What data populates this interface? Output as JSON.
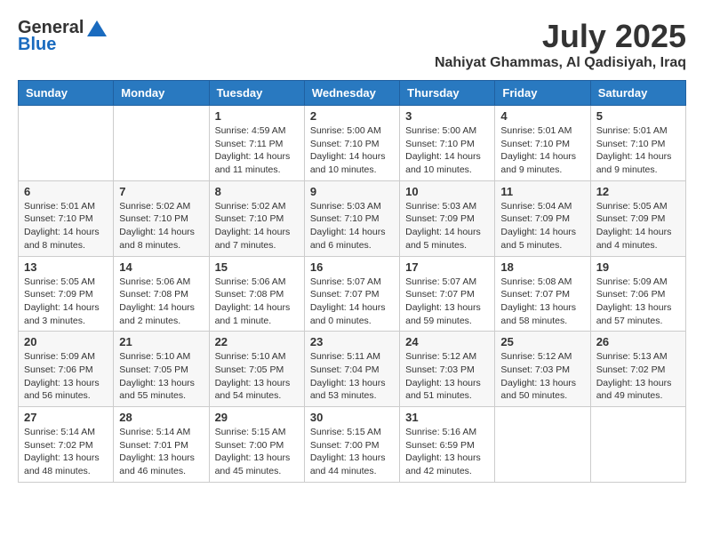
{
  "logo": {
    "general": "General",
    "blue": "Blue"
  },
  "title": "July 2025",
  "location": "Nahiyat Ghammas, Al Qadisiyah, Iraq",
  "weekdays": [
    "Sunday",
    "Monday",
    "Tuesday",
    "Wednesday",
    "Thursday",
    "Friday",
    "Saturday"
  ],
  "weeks": [
    [
      null,
      null,
      {
        "day": 1,
        "sunrise": "Sunrise: 4:59 AM",
        "sunset": "Sunset: 7:11 PM",
        "daylight": "Daylight: 14 hours and 11 minutes."
      },
      {
        "day": 2,
        "sunrise": "Sunrise: 5:00 AM",
        "sunset": "Sunset: 7:10 PM",
        "daylight": "Daylight: 14 hours and 10 minutes."
      },
      {
        "day": 3,
        "sunrise": "Sunrise: 5:00 AM",
        "sunset": "Sunset: 7:10 PM",
        "daylight": "Daylight: 14 hours and 10 minutes."
      },
      {
        "day": 4,
        "sunrise": "Sunrise: 5:01 AM",
        "sunset": "Sunset: 7:10 PM",
        "daylight": "Daylight: 14 hours and 9 minutes."
      },
      {
        "day": 5,
        "sunrise": "Sunrise: 5:01 AM",
        "sunset": "Sunset: 7:10 PM",
        "daylight": "Daylight: 14 hours and 9 minutes."
      }
    ],
    [
      {
        "day": 6,
        "sunrise": "Sunrise: 5:01 AM",
        "sunset": "Sunset: 7:10 PM",
        "daylight": "Daylight: 14 hours and 8 minutes."
      },
      {
        "day": 7,
        "sunrise": "Sunrise: 5:02 AM",
        "sunset": "Sunset: 7:10 PM",
        "daylight": "Daylight: 14 hours and 8 minutes."
      },
      {
        "day": 8,
        "sunrise": "Sunrise: 5:02 AM",
        "sunset": "Sunset: 7:10 PM",
        "daylight": "Daylight: 14 hours and 7 minutes."
      },
      {
        "day": 9,
        "sunrise": "Sunrise: 5:03 AM",
        "sunset": "Sunset: 7:10 PM",
        "daylight": "Daylight: 14 hours and 6 minutes."
      },
      {
        "day": 10,
        "sunrise": "Sunrise: 5:03 AM",
        "sunset": "Sunset: 7:09 PM",
        "daylight": "Daylight: 14 hours and 5 minutes."
      },
      {
        "day": 11,
        "sunrise": "Sunrise: 5:04 AM",
        "sunset": "Sunset: 7:09 PM",
        "daylight": "Daylight: 14 hours and 5 minutes."
      },
      {
        "day": 12,
        "sunrise": "Sunrise: 5:05 AM",
        "sunset": "Sunset: 7:09 PM",
        "daylight": "Daylight: 14 hours and 4 minutes."
      }
    ],
    [
      {
        "day": 13,
        "sunrise": "Sunrise: 5:05 AM",
        "sunset": "Sunset: 7:09 PM",
        "daylight": "Daylight: 14 hours and 3 minutes."
      },
      {
        "day": 14,
        "sunrise": "Sunrise: 5:06 AM",
        "sunset": "Sunset: 7:08 PM",
        "daylight": "Daylight: 14 hours and 2 minutes."
      },
      {
        "day": 15,
        "sunrise": "Sunrise: 5:06 AM",
        "sunset": "Sunset: 7:08 PM",
        "daylight": "Daylight: 14 hours and 1 minute."
      },
      {
        "day": 16,
        "sunrise": "Sunrise: 5:07 AM",
        "sunset": "Sunset: 7:07 PM",
        "daylight": "Daylight: 14 hours and 0 minutes."
      },
      {
        "day": 17,
        "sunrise": "Sunrise: 5:07 AM",
        "sunset": "Sunset: 7:07 PM",
        "daylight": "Daylight: 13 hours and 59 minutes."
      },
      {
        "day": 18,
        "sunrise": "Sunrise: 5:08 AM",
        "sunset": "Sunset: 7:07 PM",
        "daylight": "Daylight: 13 hours and 58 minutes."
      },
      {
        "day": 19,
        "sunrise": "Sunrise: 5:09 AM",
        "sunset": "Sunset: 7:06 PM",
        "daylight": "Daylight: 13 hours and 57 minutes."
      }
    ],
    [
      {
        "day": 20,
        "sunrise": "Sunrise: 5:09 AM",
        "sunset": "Sunset: 7:06 PM",
        "daylight": "Daylight: 13 hours and 56 minutes."
      },
      {
        "day": 21,
        "sunrise": "Sunrise: 5:10 AM",
        "sunset": "Sunset: 7:05 PM",
        "daylight": "Daylight: 13 hours and 55 minutes."
      },
      {
        "day": 22,
        "sunrise": "Sunrise: 5:10 AM",
        "sunset": "Sunset: 7:05 PM",
        "daylight": "Daylight: 13 hours and 54 minutes."
      },
      {
        "day": 23,
        "sunrise": "Sunrise: 5:11 AM",
        "sunset": "Sunset: 7:04 PM",
        "daylight": "Daylight: 13 hours and 53 minutes."
      },
      {
        "day": 24,
        "sunrise": "Sunrise: 5:12 AM",
        "sunset": "Sunset: 7:03 PM",
        "daylight": "Daylight: 13 hours and 51 minutes."
      },
      {
        "day": 25,
        "sunrise": "Sunrise: 5:12 AM",
        "sunset": "Sunset: 7:03 PM",
        "daylight": "Daylight: 13 hours and 50 minutes."
      },
      {
        "day": 26,
        "sunrise": "Sunrise: 5:13 AM",
        "sunset": "Sunset: 7:02 PM",
        "daylight": "Daylight: 13 hours and 49 minutes."
      }
    ],
    [
      {
        "day": 27,
        "sunrise": "Sunrise: 5:14 AM",
        "sunset": "Sunset: 7:02 PM",
        "daylight": "Daylight: 13 hours and 48 minutes."
      },
      {
        "day": 28,
        "sunrise": "Sunrise: 5:14 AM",
        "sunset": "Sunset: 7:01 PM",
        "daylight": "Daylight: 13 hours and 46 minutes."
      },
      {
        "day": 29,
        "sunrise": "Sunrise: 5:15 AM",
        "sunset": "Sunset: 7:00 PM",
        "daylight": "Daylight: 13 hours and 45 minutes."
      },
      {
        "day": 30,
        "sunrise": "Sunrise: 5:15 AM",
        "sunset": "Sunset: 7:00 PM",
        "daylight": "Daylight: 13 hours and 44 minutes."
      },
      {
        "day": 31,
        "sunrise": "Sunrise: 5:16 AM",
        "sunset": "Sunset: 6:59 PM",
        "daylight": "Daylight: 13 hours and 42 minutes."
      },
      null,
      null
    ]
  ]
}
